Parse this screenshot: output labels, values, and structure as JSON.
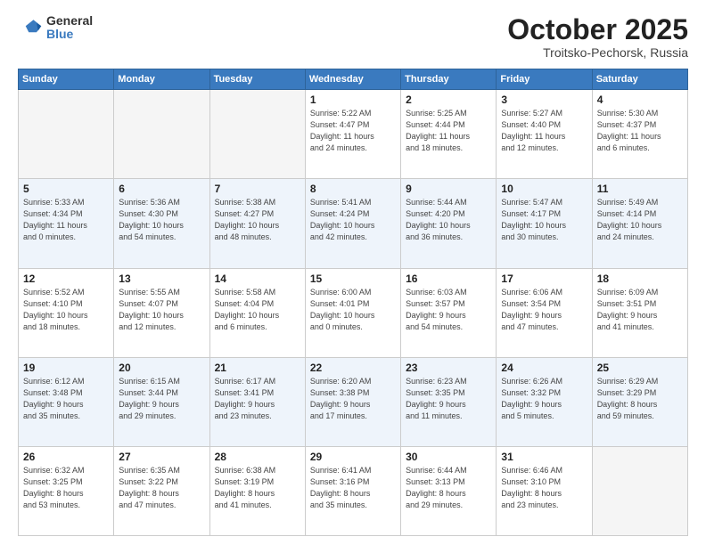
{
  "logo": {
    "line1": "General",
    "line2": "Blue"
  },
  "header": {
    "month": "October 2025",
    "location": "Troitsko-Pechorsk, Russia"
  },
  "weekdays": [
    "Sunday",
    "Monday",
    "Tuesday",
    "Wednesday",
    "Thursday",
    "Friday",
    "Saturday"
  ],
  "weeks": [
    [
      {
        "day": "",
        "info": ""
      },
      {
        "day": "",
        "info": ""
      },
      {
        "day": "",
        "info": ""
      },
      {
        "day": "1",
        "info": "Sunrise: 5:22 AM\nSunset: 4:47 PM\nDaylight: 11 hours\nand 24 minutes."
      },
      {
        "day": "2",
        "info": "Sunrise: 5:25 AM\nSunset: 4:44 PM\nDaylight: 11 hours\nand 18 minutes."
      },
      {
        "day": "3",
        "info": "Sunrise: 5:27 AM\nSunset: 4:40 PM\nDaylight: 11 hours\nand 12 minutes."
      },
      {
        "day": "4",
        "info": "Sunrise: 5:30 AM\nSunset: 4:37 PM\nDaylight: 11 hours\nand 6 minutes."
      }
    ],
    [
      {
        "day": "5",
        "info": "Sunrise: 5:33 AM\nSunset: 4:34 PM\nDaylight: 11 hours\nand 0 minutes."
      },
      {
        "day": "6",
        "info": "Sunrise: 5:36 AM\nSunset: 4:30 PM\nDaylight: 10 hours\nand 54 minutes."
      },
      {
        "day": "7",
        "info": "Sunrise: 5:38 AM\nSunset: 4:27 PM\nDaylight: 10 hours\nand 48 minutes."
      },
      {
        "day": "8",
        "info": "Sunrise: 5:41 AM\nSunset: 4:24 PM\nDaylight: 10 hours\nand 42 minutes."
      },
      {
        "day": "9",
        "info": "Sunrise: 5:44 AM\nSunset: 4:20 PM\nDaylight: 10 hours\nand 36 minutes."
      },
      {
        "day": "10",
        "info": "Sunrise: 5:47 AM\nSunset: 4:17 PM\nDaylight: 10 hours\nand 30 minutes."
      },
      {
        "day": "11",
        "info": "Sunrise: 5:49 AM\nSunset: 4:14 PM\nDaylight: 10 hours\nand 24 minutes."
      }
    ],
    [
      {
        "day": "12",
        "info": "Sunrise: 5:52 AM\nSunset: 4:10 PM\nDaylight: 10 hours\nand 18 minutes."
      },
      {
        "day": "13",
        "info": "Sunrise: 5:55 AM\nSunset: 4:07 PM\nDaylight: 10 hours\nand 12 minutes."
      },
      {
        "day": "14",
        "info": "Sunrise: 5:58 AM\nSunset: 4:04 PM\nDaylight: 10 hours\nand 6 minutes."
      },
      {
        "day": "15",
        "info": "Sunrise: 6:00 AM\nSunset: 4:01 PM\nDaylight: 10 hours\nand 0 minutes."
      },
      {
        "day": "16",
        "info": "Sunrise: 6:03 AM\nSunset: 3:57 PM\nDaylight: 9 hours\nand 54 minutes."
      },
      {
        "day": "17",
        "info": "Sunrise: 6:06 AM\nSunset: 3:54 PM\nDaylight: 9 hours\nand 47 minutes."
      },
      {
        "day": "18",
        "info": "Sunrise: 6:09 AM\nSunset: 3:51 PM\nDaylight: 9 hours\nand 41 minutes."
      }
    ],
    [
      {
        "day": "19",
        "info": "Sunrise: 6:12 AM\nSunset: 3:48 PM\nDaylight: 9 hours\nand 35 minutes."
      },
      {
        "day": "20",
        "info": "Sunrise: 6:15 AM\nSunset: 3:44 PM\nDaylight: 9 hours\nand 29 minutes."
      },
      {
        "day": "21",
        "info": "Sunrise: 6:17 AM\nSunset: 3:41 PM\nDaylight: 9 hours\nand 23 minutes."
      },
      {
        "day": "22",
        "info": "Sunrise: 6:20 AM\nSunset: 3:38 PM\nDaylight: 9 hours\nand 17 minutes."
      },
      {
        "day": "23",
        "info": "Sunrise: 6:23 AM\nSunset: 3:35 PM\nDaylight: 9 hours\nand 11 minutes."
      },
      {
        "day": "24",
        "info": "Sunrise: 6:26 AM\nSunset: 3:32 PM\nDaylight: 9 hours\nand 5 minutes."
      },
      {
        "day": "25",
        "info": "Sunrise: 6:29 AM\nSunset: 3:29 PM\nDaylight: 8 hours\nand 59 minutes."
      }
    ],
    [
      {
        "day": "26",
        "info": "Sunrise: 6:32 AM\nSunset: 3:25 PM\nDaylight: 8 hours\nand 53 minutes."
      },
      {
        "day": "27",
        "info": "Sunrise: 6:35 AM\nSunset: 3:22 PM\nDaylight: 8 hours\nand 47 minutes."
      },
      {
        "day": "28",
        "info": "Sunrise: 6:38 AM\nSunset: 3:19 PM\nDaylight: 8 hours\nand 41 minutes."
      },
      {
        "day": "29",
        "info": "Sunrise: 6:41 AM\nSunset: 3:16 PM\nDaylight: 8 hours\nand 35 minutes."
      },
      {
        "day": "30",
        "info": "Sunrise: 6:44 AM\nSunset: 3:13 PM\nDaylight: 8 hours\nand 29 minutes."
      },
      {
        "day": "31",
        "info": "Sunrise: 6:46 AM\nSunset: 3:10 PM\nDaylight: 8 hours\nand 23 minutes."
      },
      {
        "day": "",
        "info": ""
      }
    ]
  ]
}
